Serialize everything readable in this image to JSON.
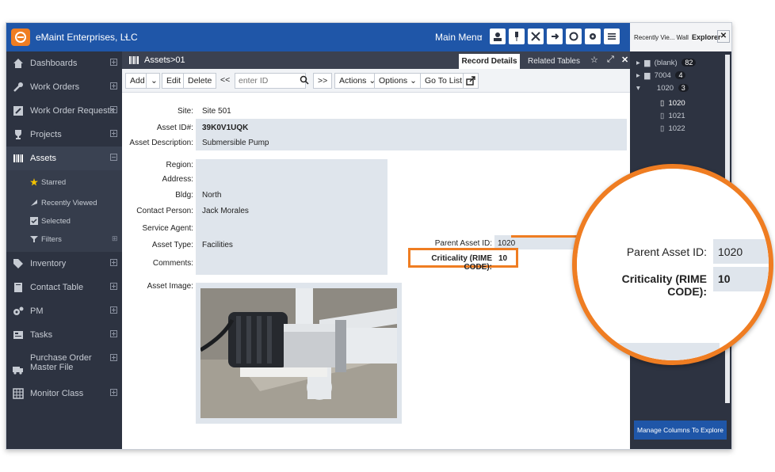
{
  "header": {
    "company": "eMaint Enterprises, LLC",
    "main_menu": "Main Menu"
  },
  "sidebar": {
    "items": [
      {
        "label": "Dashboards",
        "icon": "home-icon"
      },
      {
        "label": "Work Orders",
        "icon": "wrench-icon"
      },
      {
        "label": "Work Order Requests",
        "icon": "edit-icon"
      },
      {
        "label": "Projects",
        "icon": "trophy-icon"
      },
      {
        "label": "Assets",
        "icon": "barcode-icon"
      },
      {
        "label": "Inventory",
        "icon": "tag-icon"
      },
      {
        "label": "Contact Table",
        "icon": "book-icon"
      },
      {
        "label": "PM",
        "icon": "gears-icon"
      },
      {
        "label": "Tasks",
        "icon": "card-icon"
      },
      {
        "label": "Purchase Order Master File",
        "icon": "truck-icon"
      },
      {
        "label": "Monitor Class",
        "icon": "grid-icon"
      }
    ],
    "assets_sub": [
      {
        "label": "Starred",
        "icon": "star-icon"
      },
      {
        "label": "Recently Viewed",
        "icon": "arrow-icon"
      },
      {
        "label": "Selected",
        "icon": "checkbox-icon"
      },
      {
        "label": "Filters",
        "icon": "filter-icon"
      }
    ]
  },
  "breadcrumb": "Assets>01",
  "tabs": {
    "record_details": "Record Details",
    "related_tables": "Related Tables"
  },
  "toolbar": {
    "add": "Add",
    "edit": "Edit",
    "delete": "Delete",
    "prev": "<<",
    "enter_id_placeholder": "enter ID",
    "next": ">>",
    "actions": "Actions",
    "options": "Options",
    "go_to_list": "Go To List"
  },
  "form": {
    "site_label": "Site:",
    "site": "Site 501",
    "asset_id_label": "Asset ID#:",
    "asset_id": "39K0V1UQK",
    "desc_label": "Asset Description:",
    "desc": "Submersible Pump",
    "region_label": "Region:",
    "address_label": "Address:",
    "bldg_label": "Bldg:",
    "bldg": "North",
    "contact_label": "Contact Person:",
    "contact": "Jack Morales",
    "agent_label": "Service Agent:",
    "type_label": "Asset Type:",
    "type": "Facilities",
    "comments_label": "Comments:",
    "image_label": "Asset Image:",
    "parent_label": "Parent Asset ID:",
    "parent": "1020",
    "criticality_label": "Criticality (RIME CODE):",
    "criticality": "10"
  },
  "explorer": {
    "recent_tab": "Recently Vie... Wall",
    "explorer_tab": "Explorer",
    "tree": [
      {
        "label": "(blank)",
        "count": "82"
      },
      {
        "label": "7004",
        "count": "4"
      },
      {
        "label": "1020",
        "count": "3"
      }
    ],
    "children": [
      "1020",
      "1021",
      "1022"
    ],
    "manage_button": "Manage Columns To Explore"
  },
  "accent_color": "#ef7d22",
  "brand_color": "#1f56a8"
}
